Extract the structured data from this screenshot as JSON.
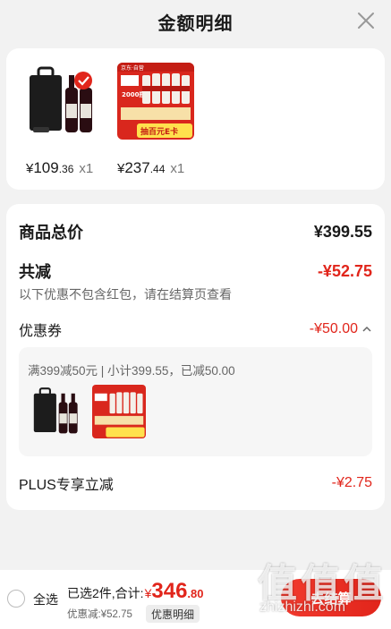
{
  "header": {
    "title": "金额明细"
  },
  "products": [
    {
      "price_symbol": "¥",
      "price_int": "109",
      "price_dec": ".36",
      "qty": "x1"
    },
    {
      "price_symbol": "¥",
      "price_int": "237",
      "price_dec": ".44",
      "qty": "x1"
    }
  ],
  "promo_image_text": {
    "badge": "京东·自营",
    "count": "2000瓶",
    "banner": "抽百元E卡"
  },
  "summary": {
    "total_label": "商品总价",
    "total_value": "¥399.55",
    "reduce_label": "共减",
    "reduce_value": "-¥52.75",
    "note": "以下优惠不包含红包，请在结算页查看",
    "coupon_label": "优惠券",
    "coupon_value": "-¥50.00",
    "coupon_desc": "满399减50元 | 小计399.55，已减50.00",
    "plus_label": "PLUS专享立减",
    "plus_value": "-¥2.75"
  },
  "bottom_bar": {
    "select_all": "全选",
    "selected_prefix": "已选2件,合计:",
    "total_currency": "¥",
    "total_int": "346",
    "total_dec": ".80",
    "discount": "优惠减:¥52.75",
    "detail_button": "优惠明细",
    "checkout": "去结算"
  },
  "watermark": {
    "glyphs": "值值值",
    "url": "zhizhizhi.com"
  },
  "colors": {
    "accent_red": "#e1251b",
    "background": "#f2f2f2",
    "card": "#ffffff"
  }
}
